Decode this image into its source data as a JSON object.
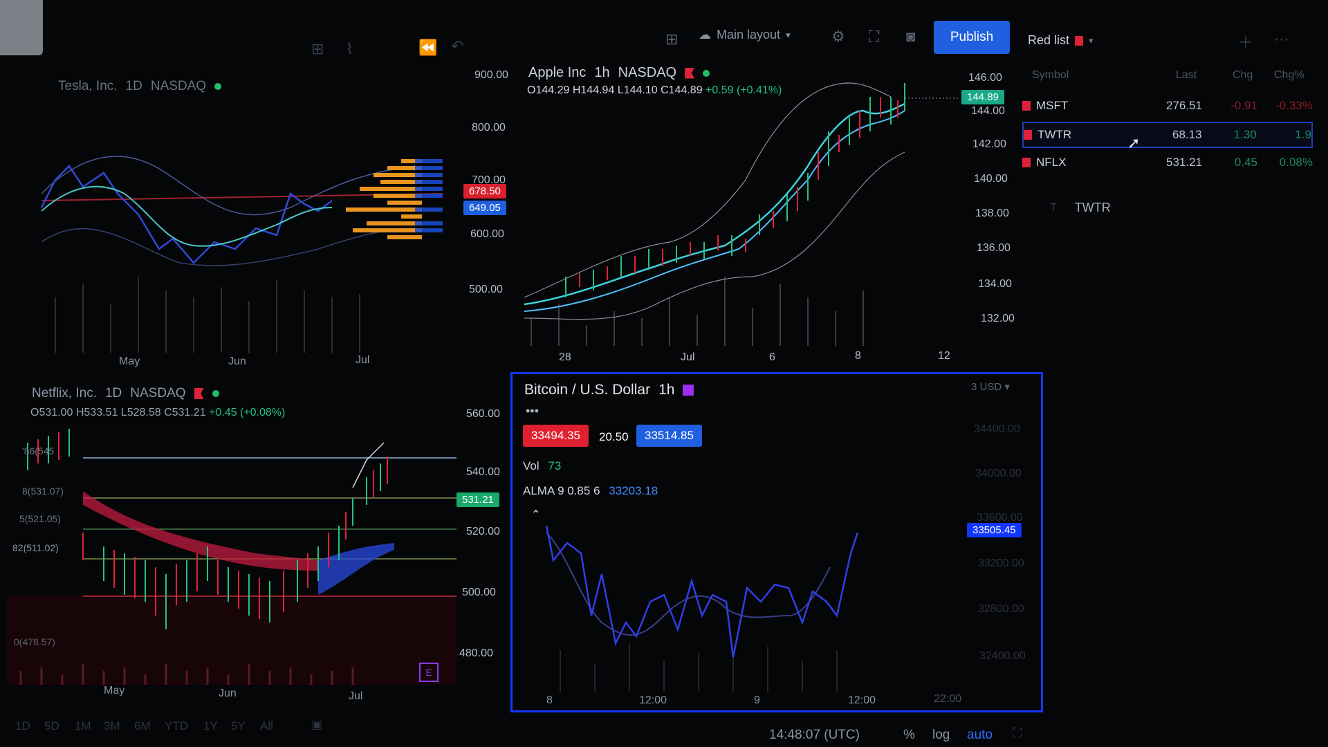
{
  "toolbar": {
    "layout_label": "Main layout",
    "publish_label": "Publish",
    "watchlist_name": "Red list"
  },
  "tesla": {
    "name": "Tesla, Inc.",
    "interval": "1D",
    "exchange": "NASDAQ",
    "x_ticks": [
      "May",
      "Jun",
      "Jul"
    ],
    "price_ticks": [
      "900.00",
      "800.00",
      "700.00",
      "600.00",
      "500.00"
    ],
    "tag_red": "678.50",
    "tag_blue": "649.05"
  },
  "apple": {
    "name": "Apple Inc",
    "interval": "1h",
    "exchange": "NASDAQ",
    "ohlc": {
      "o": "O144.29",
      "h": "H144.94",
      "l": "L144.10",
      "c": "C144.89",
      "change": "+0.59 (+0.41%)"
    },
    "price_ticks": [
      "146.00",
      "144.00",
      "142.00",
      "140.00",
      "138.00",
      "136.00",
      "134.00",
      "132.00"
    ],
    "last_tag": "144.89",
    "x_ticks": [
      "28",
      "Jul",
      "6",
      "8",
      "12"
    ]
  },
  "netflix": {
    "name": "Netflix, Inc.",
    "interval": "1D",
    "exchange": "NASDAQ",
    "ohlc": {
      "o": "O531.00",
      "h": "H533.51",
      "l": "L528.58",
      "c": "C531.21",
      "change": "+0.45 (+0.08%)"
    },
    "price_ticks": [
      "560.00",
      "540.00",
      "520.00",
      "500.00",
      "480.00"
    ],
    "last_tag": "531.21",
    "x_ticks": [
      "May",
      "Jun",
      "Jul"
    ],
    "left_labels": [
      "'86(545",
      "8(531.07)",
      "5(521.05)",
      "82(511.02)",
      "0(478.57)"
    ]
  },
  "bitcoin": {
    "name": "Bitcoin / U.S. Dollar",
    "interval": "1h",
    "currency": "USD",
    "bid": "33494.35",
    "spread": "20.50",
    "ask": "33514.85",
    "vol_label": "Vol",
    "vol_value": "73",
    "alma_label": "ALMA 9 0.85 6",
    "alma_value": "33203.18",
    "price_ticks": [
      "34400.00",
      "34000.00",
      "33600.00",
      "33200.00",
      "32800.00",
      "32400.00"
    ],
    "last_tag": "33505.45",
    "x_ticks": [
      "8",
      "12:00",
      "9",
      "12:00",
      "22:00"
    ]
  },
  "watchlist": {
    "headers": [
      "Symbol",
      "Last",
      "Chg",
      "Chg%"
    ],
    "rows": [
      {
        "symbol": "MSFT",
        "last": "276.51",
        "chg": "-0.91",
        "chgp": "-0.33%",
        "color": "#e0213a"
      },
      {
        "symbol": "TWTR",
        "last": "68.13",
        "chg": "1.30",
        "chgp": "1.9",
        "color": "#26c281"
      },
      {
        "symbol": "NFLX",
        "last": "531.21",
        "chg": "0.45",
        "chgp": "0.08%",
        "color": "#26c281"
      }
    ],
    "detail_symbol": "TWTR"
  },
  "bottom": {
    "timeframes": [
      "1D",
      "5D",
      "1M",
      "3M",
      "6M",
      "YTD",
      "1Y",
      "5Y",
      "All"
    ],
    "clock": "14:48:07 (UTC)",
    "pct": "%",
    "log": "log",
    "auto": "auto"
  },
  "chart_data": [
    {
      "type": "line",
      "title": "Tesla, Inc.",
      "categories": [
        "May",
        "Jun",
        "Jul"
      ],
      "ylim": [
        450,
        920
      ]
    },
    {
      "type": "line",
      "title": "Apple Inc",
      "categories": [
        "28",
        "Jul",
        "6",
        "8",
        "12"
      ],
      "ylim": [
        131,
        147
      ],
      "series": [
        {
          "values": [
            133.2,
            134.0,
            135.6,
            136.2,
            136.0,
            137.2,
            138.4,
            140.0,
            142.4,
            143.6,
            142.8,
            144.9
          ]
        }
      ]
    },
    {
      "type": "line",
      "title": "Netflix, Inc.",
      "categories": [
        "May",
        "Jun",
        "Jul"
      ],
      "ylim": [
        475,
        568
      ],
      "series": [
        {
          "values": [
            540,
            525,
            505,
            498,
            492,
            496,
            500,
            503,
            498,
            494,
            505,
            520,
            530,
            540,
            545,
            531
          ]
        }
      ]
    },
    {
      "type": "line",
      "title": "Bitcoin / U.S. Dollar",
      "categories": [
        "8",
        "12:00",
        "9",
        "12:00",
        "22:00"
      ],
      "ylim": [
        32300,
        34600
      ],
      "series": [
        {
          "values": [
            33600,
            33150,
            33300,
            33200,
            32600,
            32850,
            32550,
            32850,
            33000,
            32750,
            32950,
            33100,
            32950,
            32950,
            32850,
            33500
          ]
        }
      ]
    }
  ]
}
